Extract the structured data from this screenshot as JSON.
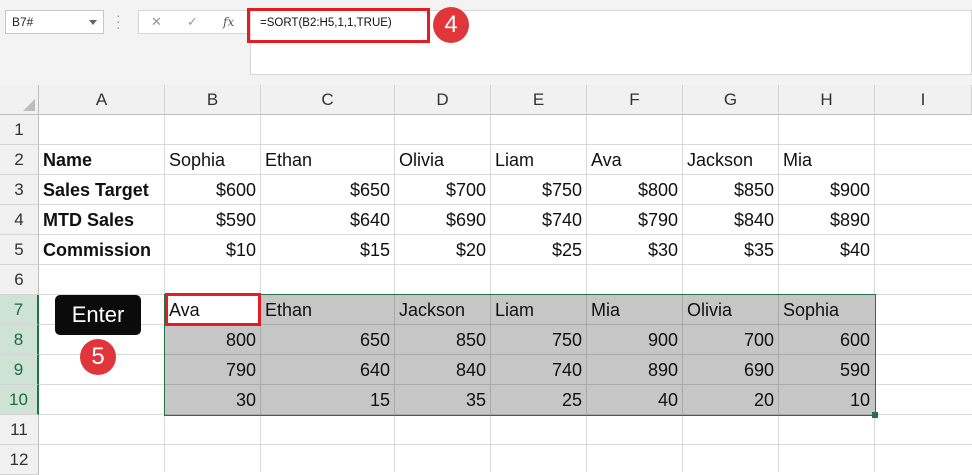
{
  "formula_bar": {
    "name_box": "B7#",
    "cancel_icon": "✕",
    "enter_icon": "✓",
    "fx_label": "fx",
    "formula": "=SORT(B2:H5,1,1,TRUE)"
  },
  "annotations": {
    "step4": "4",
    "step5": "5",
    "enter_label": "Enter",
    "highlight_color": "#e21d24"
  },
  "columns": [
    "A",
    "B",
    "C",
    "D",
    "E",
    "F",
    "G",
    "H",
    "I"
  ],
  "rows": [
    "1",
    "2",
    "3",
    "4",
    "5",
    "6",
    "7",
    "8",
    "9",
    "10",
    "11",
    "12"
  ],
  "table": {
    "row_labels": [
      "Name",
      "Sales Target",
      "MTD Sales",
      "Commission"
    ],
    "names": [
      "Sophia",
      "Ethan",
      "Olivia",
      "Liam",
      "Ava",
      "Jackson",
      "Mia"
    ],
    "sales_target": [
      "$600",
      "$650",
      "$700",
      "$750",
      "$800",
      "$850",
      "$900"
    ],
    "mtd_sales": [
      "$590",
      "$640",
      "$690",
      "$740",
      "$790",
      "$840",
      "$890"
    ],
    "commission": [
      "$10",
      "$15",
      "$20",
      "$25",
      "$30",
      "$35",
      "$40"
    ]
  },
  "sorted": {
    "names": [
      "Ava",
      "Ethan",
      "Jackson",
      "Liam",
      "Mia",
      "Olivia",
      "Sophia"
    ],
    "row1": [
      "800",
      "650",
      "850",
      "750",
      "900",
      "700",
      "600"
    ],
    "row2": [
      "790",
      "640",
      "840",
      "740",
      "890",
      "690",
      "590"
    ],
    "row3": [
      "30",
      "15",
      "35",
      "25",
      "40",
      "20",
      "10"
    ]
  },
  "colors": {
    "selected_header": "#9fd5b7",
    "spill_fill": "#c6c6c6",
    "excel_green": "#217346"
  }
}
